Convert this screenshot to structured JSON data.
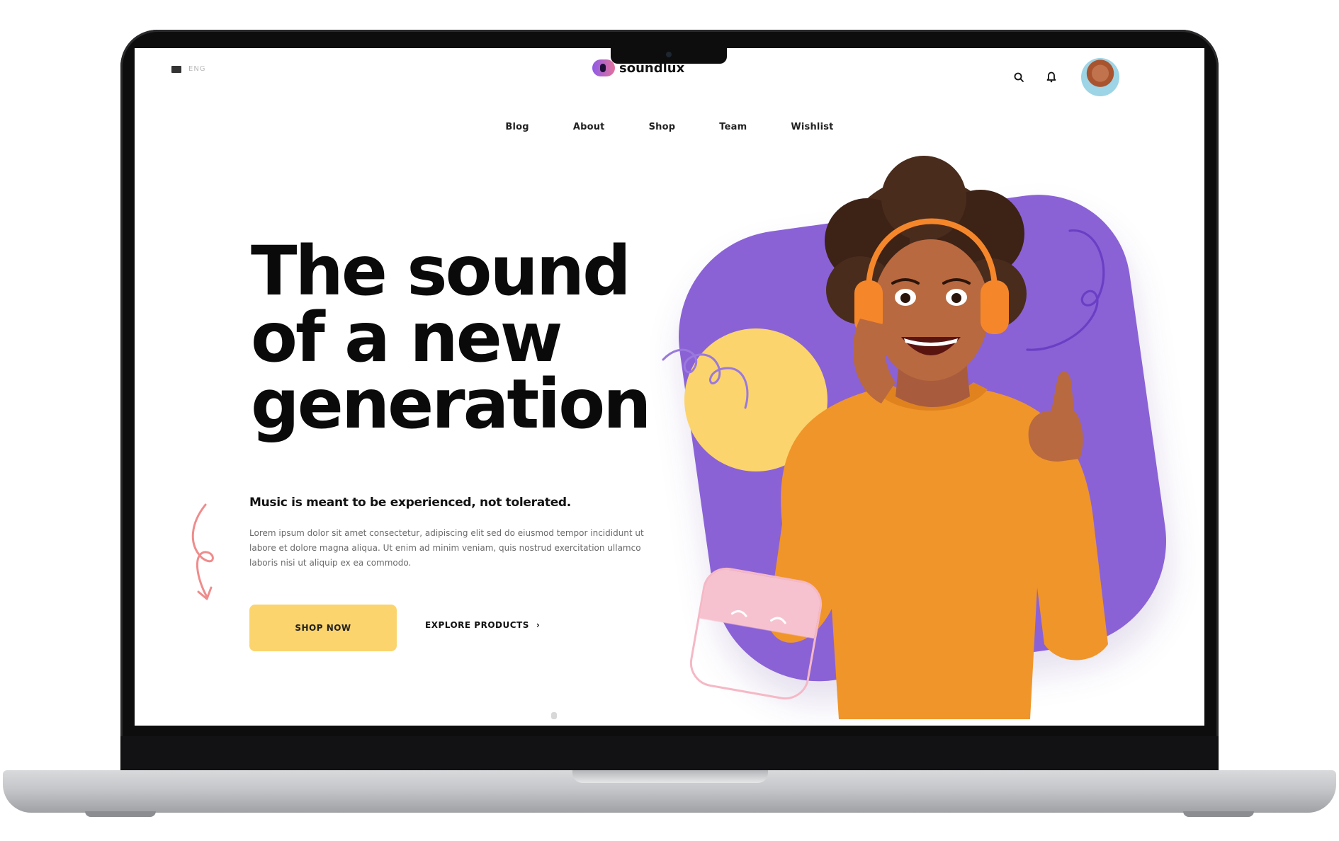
{
  "topbar": {
    "language": "ENG",
    "logo_text": "soundlux"
  },
  "nav": {
    "items": [
      "Blog",
      "About",
      "Shop",
      "Team",
      "Wishlist"
    ]
  },
  "hero": {
    "title": "The sound of a new generation",
    "subtitle": "Music is meant to be experienced, not tolerated.",
    "body": "Lorem ipsum dolor sit amet consectetur, adipiscing elit sed do eiusmod tempor incididunt ut labore et dolore magna aliqua. Ut enim ad minim veniam, quis nostrud exercitation ullamco laboris nisi ut aliquip ex ea commodo.",
    "primary_button": "SHOP NOW",
    "secondary_link": "EXPLORE PRODUCTS",
    "secondary_arrow": "›"
  },
  "colors": {
    "accent_purple": "#8a62d6",
    "accent_yellow": "#fbd46d",
    "accent_pink": "#f5b8c6",
    "sweater_orange": "#f0952a"
  },
  "icons": [
    "flag-icon",
    "search-icon",
    "bell-icon",
    "avatar",
    "arrow-right-icon"
  ]
}
